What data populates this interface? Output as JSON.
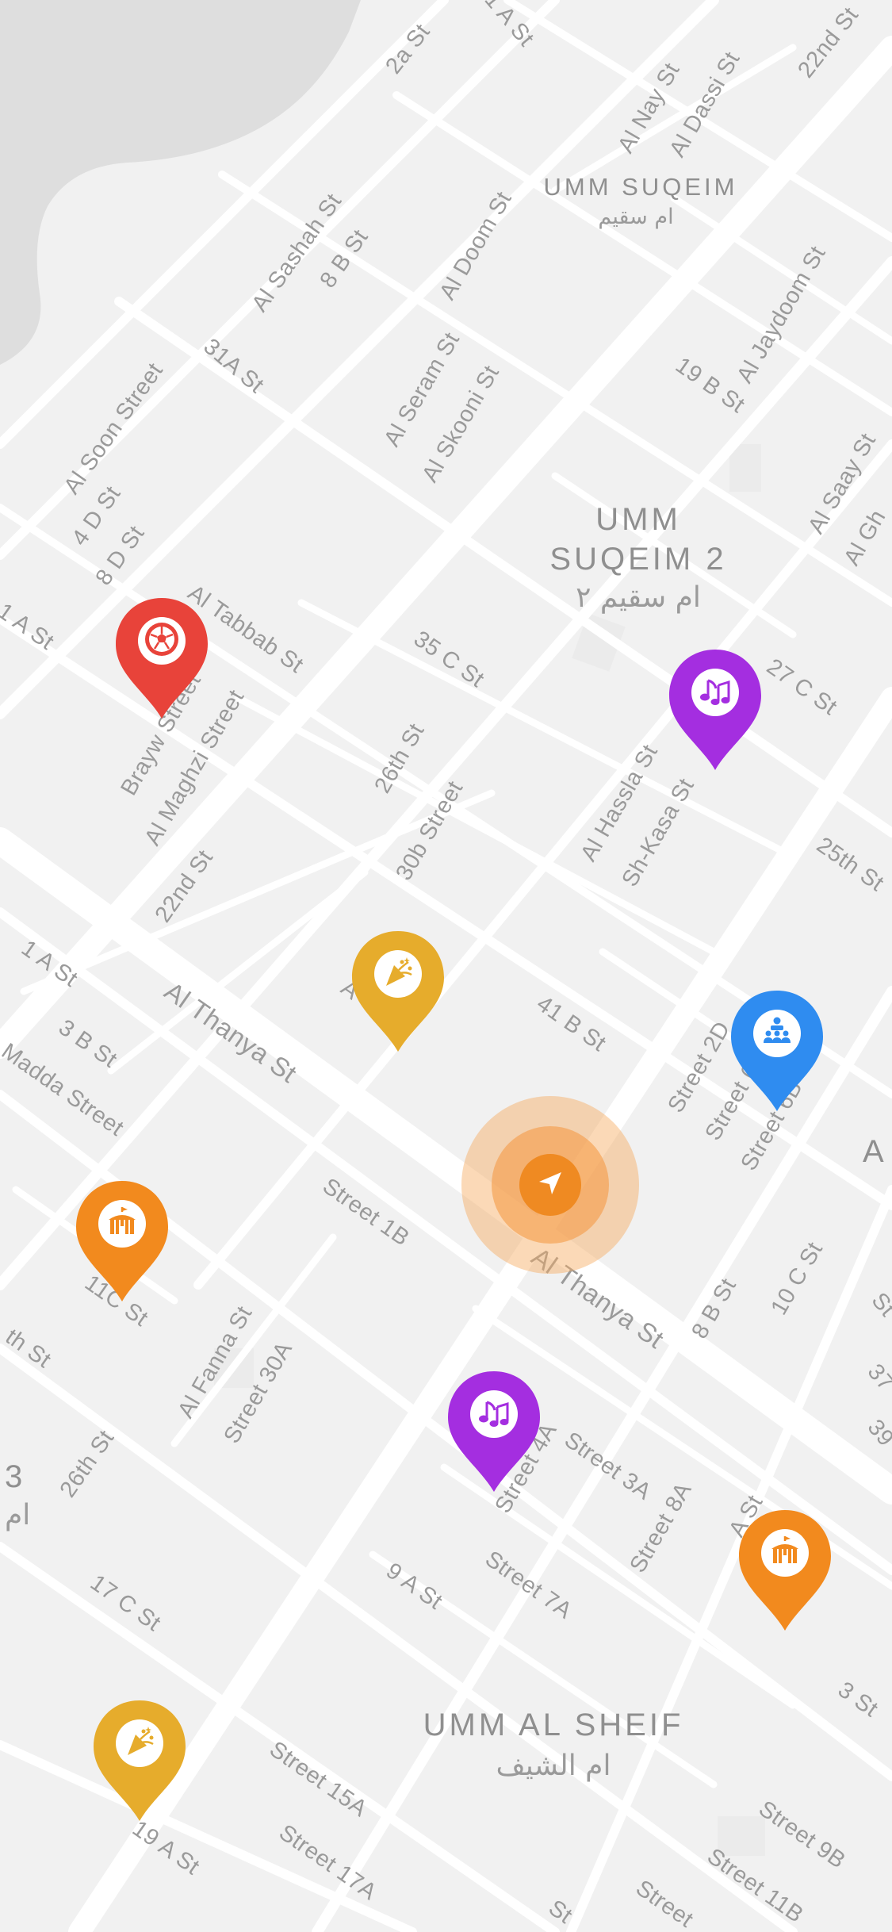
{
  "map": {
    "background_color": "#f1f1f1",
    "road_color": "#ffffff",
    "block_color": "#eaeaea",
    "water_color": "#dedede",
    "districts": [
      {
        "name": "UMM SUQEIM",
        "name_ar": "ام سقيم"
      },
      {
        "name_line1": "UMM",
        "name_line2": "SUQEIM 2",
        "name_ar": "ام سقيم ٢"
      },
      {
        "name": "UMM AL SHEIF",
        "name_ar": "ام الشيف"
      },
      {
        "name_partial": "3",
        "name_ar_partial": "ام"
      },
      {
        "name_partial": "A"
      }
    ],
    "streets": [
      "2a St",
      "1 A St",
      "22nd St",
      "Al Nay St",
      "Al Dassi St",
      "Al Sashah St",
      "8 B St",
      "Al Doom St",
      "Al Jaydoom St",
      "31A St",
      "Al Soon Street",
      "Al Seram St",
      "Al Skooni St",
      "19 B St",
      "4 D St",
      "8 D St",
      "Al Saay St",
      "Al Gh",
      "1 A St",
      "Al Tabbab St",
      "35 C St",
      "27 C St",
      "Brayw Street",
      "Al Maghzi Street",
      "26th St",
      "30b Street",
      "Al Hassla St",
      "Sh-Kasa St",
      "25th St",
      "22nd St",
      "1 A St",
      "Al Thanya St",
      "A",
      "41 B St",
      "Street 2D",
      "Street 6",
      "Street 6B",
      "3 B St",
      "Madda Street",
      "Street 1B",
      "Al Thanya St",
      "10 C St",
      "8 B St",
      "11C St",
      "th St",
      "Al Fanna St",
      "Street 30A",
      "St",
      "37",
      "39",
      "26th St",
      "Street 4A",
      "Street 3A",
      "Street 8A",
      "A St",
      "17 C St",
      "9 A St",
      "Street 7A",
      "3 St",
      "Street 15A",
      "19 A St",
      "Street 17A",
      "Street 9B",
      "Street 11B",
      "Street",
      "St"
    ]
  },
  "pins": [
    {
      "category": "sports",
      "icon": "soccer-ball-icon",
      "color": "#e8433a"
    },
    {
      "category": "music",
      "icon": "music-notes-icon",
      "color": "#a42ee0"
    },
    {
      "category": "party",
      "icon": "party-popper-icon",
      "color": "#e6ac2c"
    },
    {
      "category": "conference",
      "icon": "audience-icon",
      "color": "#2f8cf0"
    },
    {
      "category": "circus",
      "icon": "circus-tent-icon",
      "color": "#f28a1e"
    },
    {
      "category": "music",
      "icon": "music-notes-icon",
      "color": "#a42ee0"
    },
    {
      "category": "circus",
      "icon": "circus-tent-icon",
      "color": "#f28a1e"
    },
    {
      "category": "party",
      "icon": "party-popper-icon",
      "color": "#e6ac2c"
    }
  ],
  "user_location": {
    "icon": "navigation-arrow-icon",
    "color": "#ef8a22"
  }
}
